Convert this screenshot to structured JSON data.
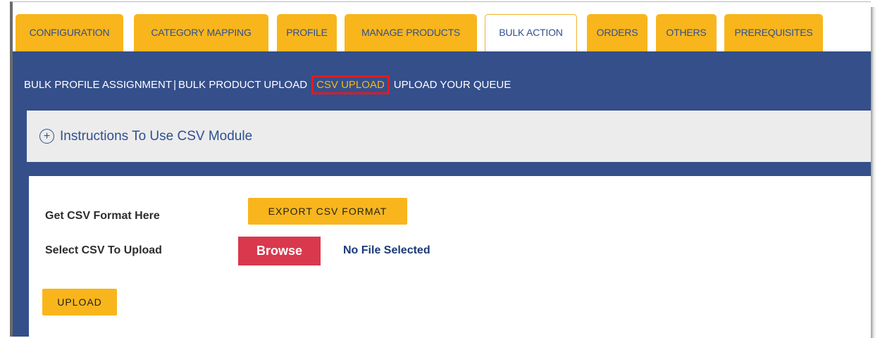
{
  "tabs": [
    {
      "label": "CONFIGURATION",
      "active": false
    },
    {
      "label": "CATEGORY MAPPING",
      "active": false
    },
    {
      "label": "PROFILE",
      "active": false
    },
    {
      "label": "MANAGE PRODUCTS",
      "active": false
    },
    {
      "label": "BULK ACTION",
      "active": true
    },
    {
      "label": "ORDERS",
      "active": false
    },
    {
      "label": "OTHERS",
      "active": false
    },
    {
      "label": "PREREQUISITES",
      "active": false
    }
  ],
  "subnav": {
    "bulk_profile": "BULK PROFILE ASSIGNMENT",
    "separator": "|",
    "bulk_product_upload": "BULK PRODUCT UPLOAD",
    "csv_upload": "CSV UPLOAD",
    "upload_queue": "UPLOAD YOUR QUEUE"
  },
  "instructions": {
    "icon": "plus-circle-icon",
    "title": "Instructions To Use CSV Module"
  },
  "form": {
    "get_csv_label": "Get CSV Format Here",
    "export_button": "EXPORT CSV FORMAT",
    "select_csv_label": "Select CSV To Upload",
    "browse_button": "Browse",
    "file_status": "No File Selected",
    "upload_button": "UPLOAD"
  },
  "colors": {
    "tab_yellow": "#f8b61c",
    "navy": "#354f8a",
    "browse_red": "#d9384d",
    "highlight_red": "#e01b24"
  }
}
